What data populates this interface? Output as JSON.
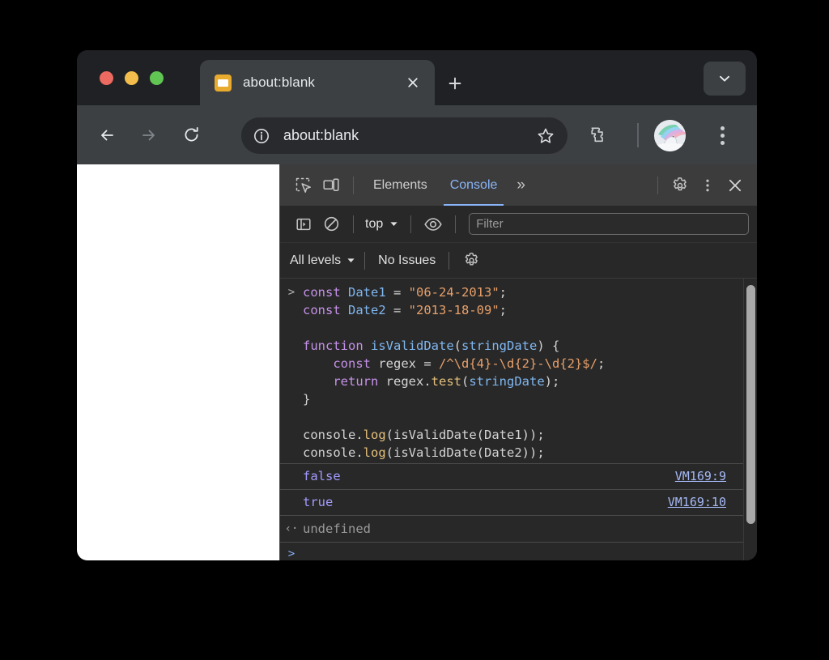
{
  "window": {
    "traffic_lights": [
      "close",
      "minimize",
      "maximize"
    ],
    "tab": {
      "title": "about:blank",
      "favicon": "page-favicon",
      "close_label": "×"
    },
    "new_tab_label": "+",
    "tab_list_label": "⌄"
  },
  "toolbar": {
    "back_label": "←",
    "forward_label": "→",
    "reload_label": "↻",
    "url": "about:blank",
    "info_icon": "site-info-icon",
    "star_icon": "bookmark-star-icon",
    "extensions_icon": "extensions-puzzle-icon",
    "avatar_icon": "profile-avatar",
    "menu_icon": "browser-menu-icon"
  },
  "devtools": {
    "inspect_icon": "inspect-element-icon",
    "device_icon": "device-toolbar-icon",
    "tabs": [
      {
        "label": "Elements",
        "active": false
      },
      {
        "label": "Console",
        "active": true
      }
    ],
    "more_tabs_label": "»",
    "settings_icon": "settings-gear-icon",
    "kebab_icon": "more-options-icon",
    "close_icon": "close-devtools-icon",
    "console_toolbar": {
      "sidebar_icon": "console-sidebar-icon",
      "clear_icon": "clear-console-icon",
      "context": "top",
      "context_caret": "▼",
      "eye_icon": "live-expression-icon",
      "filter_placeholder": "Filter",
      "filter_value": ""
    },
    "console_toolbar2": {
      "levels": "All levels",
      "levels_caret": "▼",
      "issues": "No Issues",
      "settings_icon": "console-settings-gear-icon"
    }
  },
  "console": {
    "prompt_glyph": ">",
    "eval_glyph": "‹·",
    "command_lines": [
      [
        {
          "t": "const ",
          "c": "kw"
        },
        {
          "t": "Date1 ",
          "c": "id"
        },
        {
          "t": "= ",
          "c": "pl"
        },
        {
          "t": "\"06-24-2013\"",
          "c": "str"
        },
        {
          "t": ";",
          "c": "pl"
        }
      ],
      [
        {
          "t": "const ",
          "c": "kw"
        },
        {
          "t": "Date2 ",
          "c": "id"
        },
        {
          "t": "= ",
          "c": "pl"
        },
        {
          "t": "\"2013-18-09\"",
          "c": "str"
        },
        {
          "t": ";",
          "c": "pl"
        }
      ],
      [],
      [
        {
          "t": "function ",
          "c": "kw"
        },
        {
          "t": "isValidDate",
          "c": "id"
        },
        {
          "t": "(",
          "c": "pl"
        },
        {
          "t": "stringDate",
          "c": "id"
        },
        {
          "t": ") {",
          "c": "pl"
        }
      ],
      [
        {
          "t": "    ",
          "c": "pl"
        },
        {
          "t": "const ",
          "c": "kw"
        },
        {
          "t": "regex ",
          "c": "pl"
        },
        {
          "t": "= ",
          "c": "pl"
        },
        {
          "t": "/^\\d{4}-\\d{2}-\\d{2}$/",
          "c": "str"
        },
        {
          "t": ";",
          "c": "pl"
        }
      ],
      [
        {
          "t": "    ",
          "c": "pl"
        },
        {
          "t": "return ",
          "c": "kw"
        },
        {
          "t": "regex.",
          "c": "pl"
        },
        {
          "t": "test",
          "c": "fn"
        },
        {
          "t": "(",
          "c": "pl"
        },
        {
          "t": "stringDate",
          "c": "id"
        },
        {
          "t": ");",
          "c": "pl"
        }
      ],
      [
        {
          "t": "}",
          "c": "pl"
        }
      ],
      [],
      [
        {
          "t": "console.",
          "c": "pl"
        },
        {
          "t": "log",
          "c": "fn"
        },
        {
          "t": "(",
          "c": "pl"
        },
        {
          "t": "isValidDate",
          "c": "pl"
        },
        {
          "t": "(",
          "c": "pl"
        },
        {
          "t": "Date1",
          "c": "pl"
        },
        {
          "t": "));",
          "c": "pl"
        }
      ],
      [
        {
          "t": "console.",
          "c": "pl"
        },
        {
          "t": "log",
          "c": "fn"
        },
        {
          "t": "(",
          "c": "pl"
        },
        {
          "t": "isValidDate",
          "c": "pl"
        },
        {
          "t": "(",
          "c": "pl"
        },
        {
          "t": "Date2",
          "c": "pl"
        },
        {
          "t": "));",
          "c": "pl"
        }
      ]
    ],
    "results": [
      {
        "value": "false",
        "source": "VM169:9"
      },
      {
        "value": "true",
        "source": "VM169:10"
      }
    ],
    "evaluation": "undefined"
  },
  "colors": {
    "accent": "#8ab4f8",
    "devtools_bg": "#282828",
    "chrome_bg": "#3c4043",
    "keyword": "#c792ea",
    "string": "#e8a06a",
    "identifier": "#80b7f0",
    "function": "#e5c07b",
    "result": "#a29bfe",
    "link": "#a5b9f5"
  }
}
